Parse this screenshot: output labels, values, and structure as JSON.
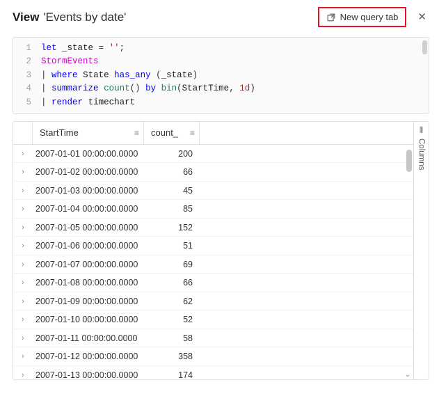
{
  "header": {
    "title_prefix": "View",
    "title_name": "'Events by date'",
    "new_query_label": "New query tab"
  },
  "code": {
    "lines": [
      {
        "n": "1",
        "html": "<span class='tk-kw'>let</span> <span class='tk-var'>_state</span> <span class='tk-punc'>=</span> <span class='tk-str'>''</span><span class='tk-punc'>;</span>"
      },
      {
        "n": "2",
        "html": "<span class='tk-render'>StormEvents</span>"
      },
      {
        "n": "3",
        "html": "<span class='tk-punc'>|</span> <span class='tk-where'>where</span> <span class='tk-axis'>State</span> <span class='tk-cmd'>has_any</span> <span class='tk-punc'>(</span><span class='tk-var'>_state</span><span class='tk-punc'>)</span>"
      },
      {
        "n": "4",
        "html": "<span class='tk-punc'>|</span> <span class='tk-cmd'>summarize</span> <span class='tk-bin'>count</span><span class='tk-punc'>()</span> <span class='tk-cmd'>by</span> <span class='tk-bin'>bin</span><span class='tk-punc'>(</span><span class='tk-axis'>StartTime</span><span class='tk-punc'>,</span> <span class='tk-str'>1d</span><span class='tk-punc'>)</span>"
      },
      {
        "n": "5",
        "html": "<span class='tk-punc'>|</span> <span class='tk-cmd'>render</span> <span class='tk-axis'>timechart</span>"
      }
    ]
  },
  "table": {
    "columns_rail_label": "Columns",
    "headers": {
      "col1": "StartTime",
      "col2": "count_"
    },
    "rows": [
      {
        "t": "2007-01-01 00:00:00.0000",
        "c": "200"
      },
      {
        "t": "2007-01-02 00:00:00.0000",
        "c": "66"
      },
      {
        "t": "2007-01-03 00:00:00.0000",
        "c": "45"
      },
      {
        "t": "2007-01-04 00:00:00.0000",
        "c": "85"
      },
      {
        "t": "2007-01-05 00:00:00.0000",
        "c": "152"
      },
      {
        "t": "2007-01-06 00:00:00.0000",
        "c": "51"
      },
      {
        "t": "2007-01-07 00:00:00.0000",
        "c": "69"
      },
      {
        "t": "2007-01-08 00:00:00.0000",
        "c": "66"
      },
      {
        "t": "2007-01-09 00:00:00.0000",
        "c": "62"
      },
      {
        "t": "2007-01-10 00:00:00.0000",
        "c": "52"
      },
      {
        "t": "2007-01-11 00:00:00.0000",
        "c": "58"
      },
      {
        "t": "2007-01-12 00:00:00.0000",
        "c": "358"
      },
      {
        "t": "2007-01-13 00:00:00.0000",
        "c": "174"
      }
    ]
  }
}
